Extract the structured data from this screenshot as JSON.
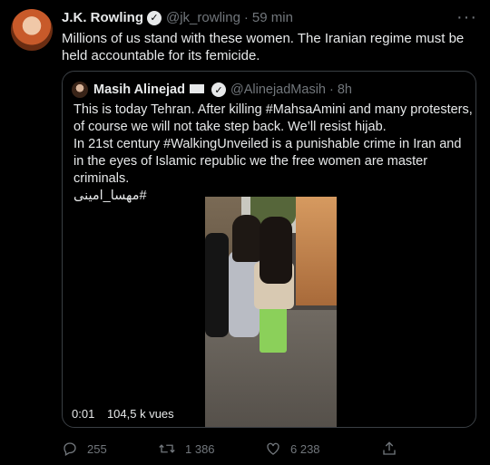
{
  "tweet": {
    "author_name": "J.K. Rowling",
    "verified_glyph": "✓",
    "handle": "@jk_rowling",
    "separator": "·",
    "time": "59 min",
    "more_glyph": "···",
    "text": "Millions of us stand with these women. The Iranian regime must be held accountable for its femicide."
  },
  "quote": {
    "author_name": "Masih Alinejad",
    "verified_glyph": "✓",
    "handle": "@AlinejadMasih",
    "separator": "·",
    "time": "8h",
    "lines": [
      "This is today Tehran. After killing #MahsaAmini and many protesters, of course we will not take step back. We’ll resist hijab.",
      "In 21st century #WalkingUnveiled is a punishable crime in Iran and in the eyes of Islamic republic we the free women are master criminals.",
      "#مهسا_امینی"
    ],
    "video": {
      "elapsed": "0:01",
      "views": "104,5 k vues"
    }
  },
  "actions": {
    "reply_count": "255",
    "retweet_count": "1 386",
    "like_count": "6 238"
  },
  "icons": {
    "reply": "reply-icon",
    "retweet": "retweet-icon",
    "like": "heart-icon",
    "share": "share-icon"
  },
  "colors": {
    "background": "#000000",
    "text": "#e7e9ea",
    "secondary": "#71767b",
    "border": "#3a3f44"
  }
}
